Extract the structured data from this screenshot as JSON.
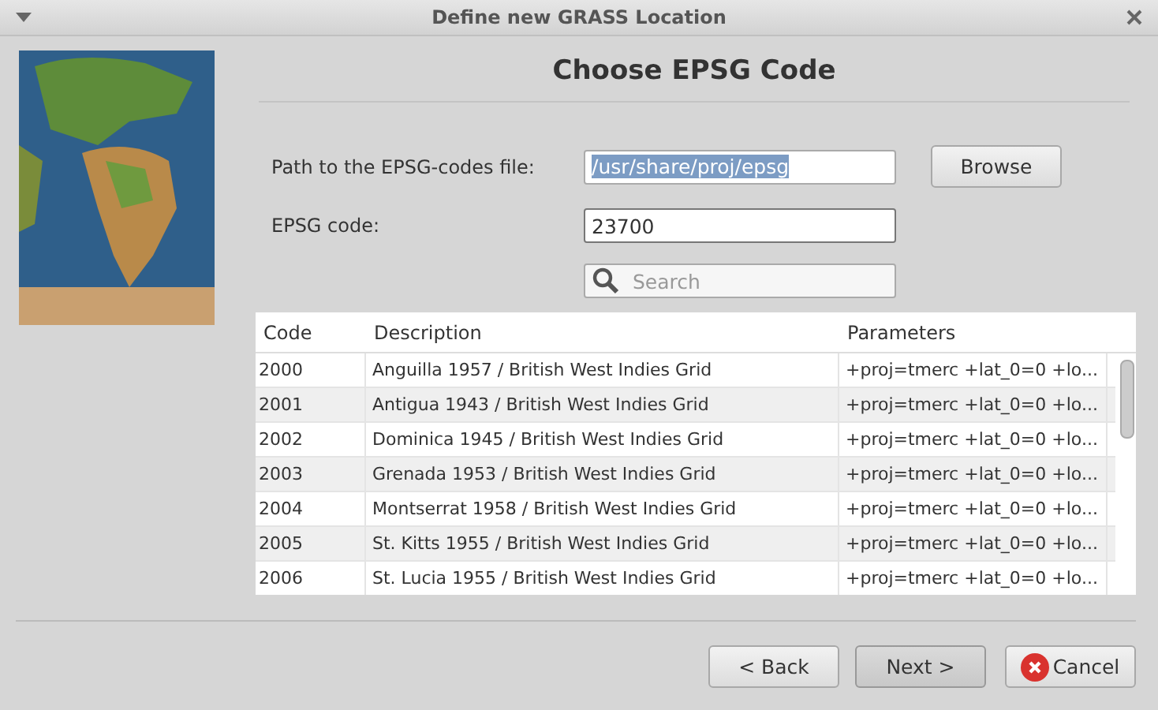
{
  "window": {
    "title": "Define new GRASS Location"
  },
  "heading": "Choose EPSG Code",
  "path_field": {
    "label": "Path to the EPSG-codes file:",
    "value": "/usr/share/proj/epsg",
    "text_selected": true
  },
  "browse_button": "Browse",
  "code_field": {
    "label": "EPSG code:",
    "value": "23700"
  },
  "search": {
    "placeholder": "Search"
  },
  "table": {
    "columns": [
      "Code",
      "Description",
      "Parameters"
    ],
    "rows": [
      {
        "cells": [
          "2000",
          "Anguilla 1957 / British West Indies Grid",
          "+proj=tmerc +lat_0=0 +lo..."
        ]
      },
      {
        "cells": [
          "2001",
          "Antigua 1943 / British West Indies Grid",
          "+proj=tmerc +lat_0=0 +lo..."
        ]
      },
      {
        "cells": [
          "2002",
          "Dominica 1945 / British West Indies Grid",
          "+proj=tmerc +lat_0=0 +lo..."
        ]
      },
      {
        "cells": [
          "2003",
          "Grenada 1953 / British West Indies Grid",
          "+proj=tmerc +lat_0=0 +lo..."
        ]
      },
      {
        "cells": [
          "2004",
          "Montserrat 1958 / British West Indies Grid",
          "+proj=tmerc +lat_0=0 +lo..."
        ]
      },
      {
        "cells": [
          "2005",
          "St. Kitts 1955 / British West Indies Grid",
          "+proj=tmerc +lat_0=0 +lo..."
        ]
      },
      {
        "cells": [
          "2006",
          "St. Lucia 1955 / British West Indies Grid",
          "+proj=tmerc +lat_0=0 +lo..."
        ]
      }
    ]
  },
  "buttons": [
    {
      "label": "< Back",
      "kind": "plain",
      "default": false
    },
    {
      "label": "Next >",
      "kind": "plain",
      "default": true
    },
    {
      "label": "Cancel",
      "kind": "cancel",
      "default": false
    }
  ]
}
